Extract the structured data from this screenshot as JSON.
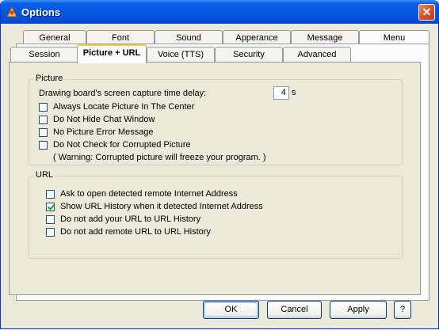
{
  "window": {
    "title": "Options",
    "close_glyph": "✕"
  },
  "tabs_back_row": [
    "General",
    "Font",
    "Sound",
    "Apperance",
    "Message",
    "Menu"
  ],
  "tabs_front_row": [
    "Session",
    "Picture + URL",
    "Voice (TTS)",
    "Security",
    "Advanced"
  ],
  "active_tab": "Picture + URL",
  "picture": {
    "legend": "Picture",
    "delay_label": "Drawing board's screen capture time delay:",
    "delay_value": "4",
    "delay_unit": "s",
    "options": [
      {
        "label": "Always Locate Picture In The Center",
        "checked": false
      },
      {
        "label": "Do Not Hide Chat Window",
        "checked": false
      },
      {
        "label": "No Picture Error Message",
        "checked": false
      },
      {
        "label": "Do Not Check for Corrupted Picture",
        "checked": false
      }
    ],
    "warning": "( Warning: Corrupted picture will freeze your program. )"
  },
  "url": {
    "legend": "URL",
    "options": [
      {
        "label": "Ask to open detected remote Internet Address",
        "checked": false
      },
      {
        "label": "Show URL History when it detected Internet Address",
        "checked": true
      },
      {
        "label": "Do not add your URL to URL History",
        "checked": false
      },
      {
        "label": "Do not add remote URL to URL History",
        "checked": false
      }
    ]
  },
  "buttons": {
    "ok": "OK",
    "cancel": "Cancel",
    "apply": "Apply",
    "help": "?"
  },
  "colors": {
    "titlebar": "#0556E2",
    "window_bg": "#ECE9D8",
    "close": "#D4542C"
  }
}
